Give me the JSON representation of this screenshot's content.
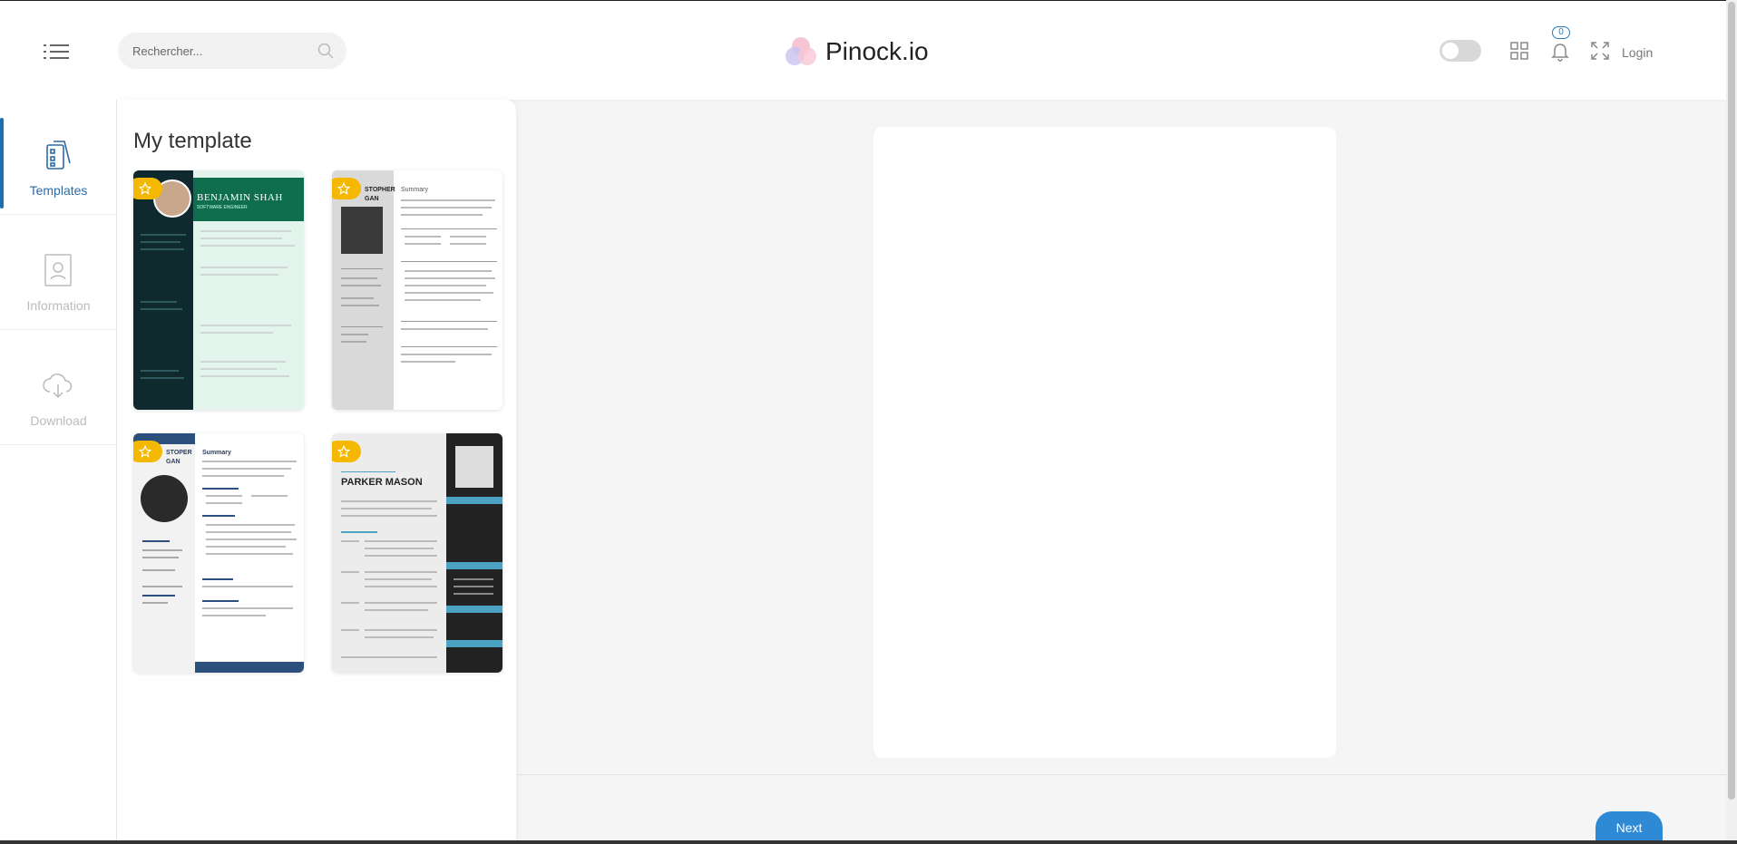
{
  "header": {
    "search_placeholder": "Rechercher...",
    "brand": "Pinock.io",
    "notification_count": "0",
    "login": "Login"
  },
  "rail": {
    "items": [
      {
        "label": "Templates",
        "icon": "templates-icon",
        "active": true
      },
      {
        "label": "Information",
        "icon": "user-card-icon",
        "active": false
      },
      {
        "label": "Download",
        "icon": "cloud-download-icon",
        "active": false
      }
    ]
  },
  "panel": {
    "title": "My template",
    "templates": [
      {
        "name_line1": "BENJAMIN SHAH",
        "subtitle": "SOFTWARE ENGINEER"
      },
      {
        "name_fragment_1": "STOPHER",
        "name_fragment_2": "GAN",
        "heading": "Summary"
      },
      {
        "name_fragment_1": "STOPER",
        "name_fragment_2": "GAN",
        "heading": "Summary"
      },
      {
        "name_line1": "PARKER MASON"
      }
    ]
  },
  "footer": {
    "next": "Next"
  },
  "colors": {
    "accent": "#2f8ad6",
    "star": "#f5b800",
    "active_rail": "#1e6fb0"
  }
}
